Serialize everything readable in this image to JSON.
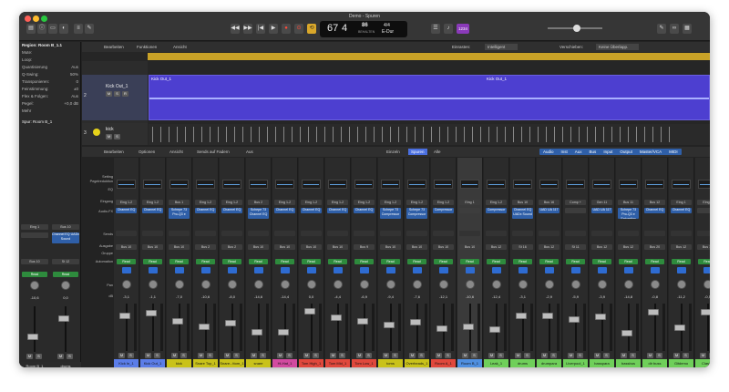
{
  "window": {
    "title": "Demo - Spuren"
  },
  "transport": {
    "bar": "67",
    "beat": "4",
    "tempo": "86",
    "tempo_label": "BEHALTEN",
    "timesig": "4/4",
    "key": "E-Dur",
    "cpu_badge": "1234"
  },
  "inspector": {
    "region_label": "Region: Room B_1.1",
    "rows": [
      {
        "label": "Mute:",
        "value": ""
      },
      {
        "label": "Loop:",
        "value": ""
      },
      {
        "label": "Quantisierung",
        "value": "Aus"
      },
      {
        "label": "Q-Swing:",
        "value": "50%"
      },
      {
        "label": "Transponieren:",
        "value": "0"
      },
      {
        "label": "Feinstimmung:",
        "value": "±0"
      },
      {
        "label": "Flex & Folgen:",
        "value": "Aus"
      },
      {
        "label": "Pegel:",
        "value": "+0,0 dB"
      }
    ],
    "more": "Mehr",
    "track_label": "Spur: Room B_1"
  },
  "tracks_toolbar": {
    "edit": "Bearbeiten",
    "functions": "Funktionen",
    "view": "Ansicht",
    "snap_label": "Einrasten:",
    "snap_value": "Intelligent",
    "move_label": "Verschieben:",
    "move_value": "Keine Überlapp."
  },
  "tracks": [
    {
      "num": "2",
      "name": "Kick Out_1",
      "region": "Kick Out_1"
    },
    {
      "num": "3",
      "name": "kick",
      "region": ""
    }
  ],
  "mixer_toolbar": {
    "edit": "Bearbeiten",
    "options": "Optionen",
    "view": "Ansicht",
    "sends": "Sends auf Fadern",
    "sends_value": "Aus",
    "tab_single": "Einzeln",
    "tab_tracks": "Spuren",
    "tab_all": "Alle",
    "filters": [
      "Audio",
      "Inst",
      "Aux",
      "Bus",
      "Input",
      "Output",
      "Master/VCA",
      "MIDI"
    ]
  },
  "mixer_rows": [
    "Setting",
    "Pegelreduktion",
    "EQ",
    "Eingang",
    "Audio-FX",
    "Sends",
    "Ausgabe",
    "Gruppe",
    "Automation",
    "Pan",
    "dB"
  ],
  "left_strips": [
    {
      "input": "Eing 1",
      "fx": "",
      "output": "Bus 10",
      "auto": "Read",
      "db": "-10,6",
      "name": "Room B_1",
      "color": "#4f8fe0"
    },
    {
      "input": "Bus 10",
      "fx": "Channel EQ  UADx Sound",
      "output": "St 12",
      "auto": "Read",
      "db": "0,0",
      "name": "drums",
      "color": "#9a9a9a"
    }
  ],
  "strips": [
    {
      "input": "Eing 1-2",
      "fx": "Channel EQ",
      "output": "Bus 10",
      "db": "-3,1",
      "name": "Kick In_1",
      "color": "#5b7de8"
    },
    {
      "input": "Eing 1-2",
      "fx": "Channel EQ",
      "output": "Bus 10",
      "db": "-1,1",
      "name": "Kick Out_1",
      "color": "#5b7de8"
    },
    {
      "input": "Bus 1",
      "fx": "Schepe 73  Pro-Q3 e",
      "output": "Bus 10",
      "db": "-7,0",
      "name": "kick",
      "color": "#c9c21a"
    },
    {
      "input": "Eing 1-2",
      "fx": "Channel EQ",
      "output": "Bus 2",
      "db": "-10,6",
      "name": "Snare Top_1",
      "color": "#c9c21a"
    },
    {
      "input": "Eing 1-2",
      "fx": "Channel EQ",
      "output": "Bus 2",
      "db": "-8,0",
      "name": "Snare...ttom_1",
      "color": "#c9c21a"
    },
    {
      "input": "Bus 2",
      "fx": "Schepe 73  Channel EQ",
      "output": "Bus 10",
      "db": "-14,6",
      "name": "snare",
      "color": "#c9c21a"
    },
    {
      "input": "Eing 1-2",
      "fx": "Channel EQ",
      "output": "Bus 10",
      "db": "-14,4",
      "name": "Hi-Hat_1",
      "color": "#d24aa0"
    },
    {
      "input": "Eing 1-2",
      "fx": "Channel EQ",
      "output": "Bus 10",
      "db": "0,0",
      "name": "Tom High_1",
      "color": "#e0483c"
    },
    {
      "input": "Eing 1-2",
      "fx": "Channel EQ",
      "output": "Bus 10",
      "db": "-4,4",
      "name": "Tom Mid_1",
      "color": "#e0483c"
    },
    {
      "input": "Eing 1-2",
      "fx": "Channel EQ",
      "output": "Bus 9",
      "db": "-6,9",
      "name": "Tom Low_1",
      "color": "#e0483c"
    },
    {
      "input": "Eing 1-2",
      "fx": "Schepe 73  Compressor",
      "output": "Bus 10",
      "db": "-9,4",
      "name": "toms",
      "color": "#c9c21a"
    },
    {
      "input": "Eing 1-2",
      "fx": "Schepe 73  Compressor",
      "output": "Bus 10",
      "db": "-7,6",
      "name": "Overheads_1",
      "color": "#c9c21a"
    },
    {
      "input": "Eing 1-2",
      "fx": "Compressor",
      "output": "Bus 10",
      "db": "-12,1",
      "name": "Room A_1",
      "color": "#e0483c"
    },
    {
      "input": "Eing 1",
      "fx": "",
      "output": "Bus 10",
      "db": "-10,6",
      "name": "Room B_1",
      "color": "#4f8fe0"
    },
    {
      "input": "Eing 1-2",
      "fx": "Compressor",
      "output": "Bus 12",
      "db": "-12,4",
      "name": "Leak_1",
      "color": "#6fcf5a"
    },
    {
      "input": "Bus 10",
      "fx": "Channel EQ  UADx Sound",
      "output": "St 16",
      "db": "-3,1",
      "name": "drums",
      "color": "#6fcf5a"
    },
    {
      "input": "Bus 16",
      "fx": "UAD UA 117",
      "output": "Bus 12",
      "db": "-2,9",
      "name": "drumpara",
      "color": "#6fcf5a"
    },
    {
      "input": "Comp +",
      "fx": "",
      "output": "St 11",
      "db": "-5,9",
      "name": "Liverpool_1",
      "color": "#6fcf5a"
    },
    {
      "input": "Gen 11",
      "fx": "UAD UA 117",
      "output": "Bus 12",
      "db": "-3,9",
      "name": "basspara",
      "color": "#6fcf5a"
    },
    {
      "input": "Bus 11",
      "fx": "Schepe 73  Pro-Q3 e  Saturation",
      "output": "Bus 12",
      "db": "-14,8",
      "name": "bassbus",
      "color": "#6fcf5a"
    },
    {
      "input": "Bus 12",
      "fx": "Channel EQ",
      "output": "Bus 20",
      "db": "-0,8",
      "name": "dir buss",
      "color": "#6fcf5a"
    },
    {
      "input": "Eing 1",
      "fx": "Channel EQ",
      "output": "Bus 12",
      "db": "-11,2",
      "name": "Gitdemo",
      "color": "#6fcf5a"
    },
    {
      "input": "Eing 1",
      "fx": "",
      "output": "Bus 12",
      "db": "-0,5",
      "name": "Classic",
      "color": "#6fcf5a"
    }
  ],
  "common": {
    "auto": "Read",
    "m": "M",
    "s": "S",
    "r": "R",
    "i": "I"
  }
}
